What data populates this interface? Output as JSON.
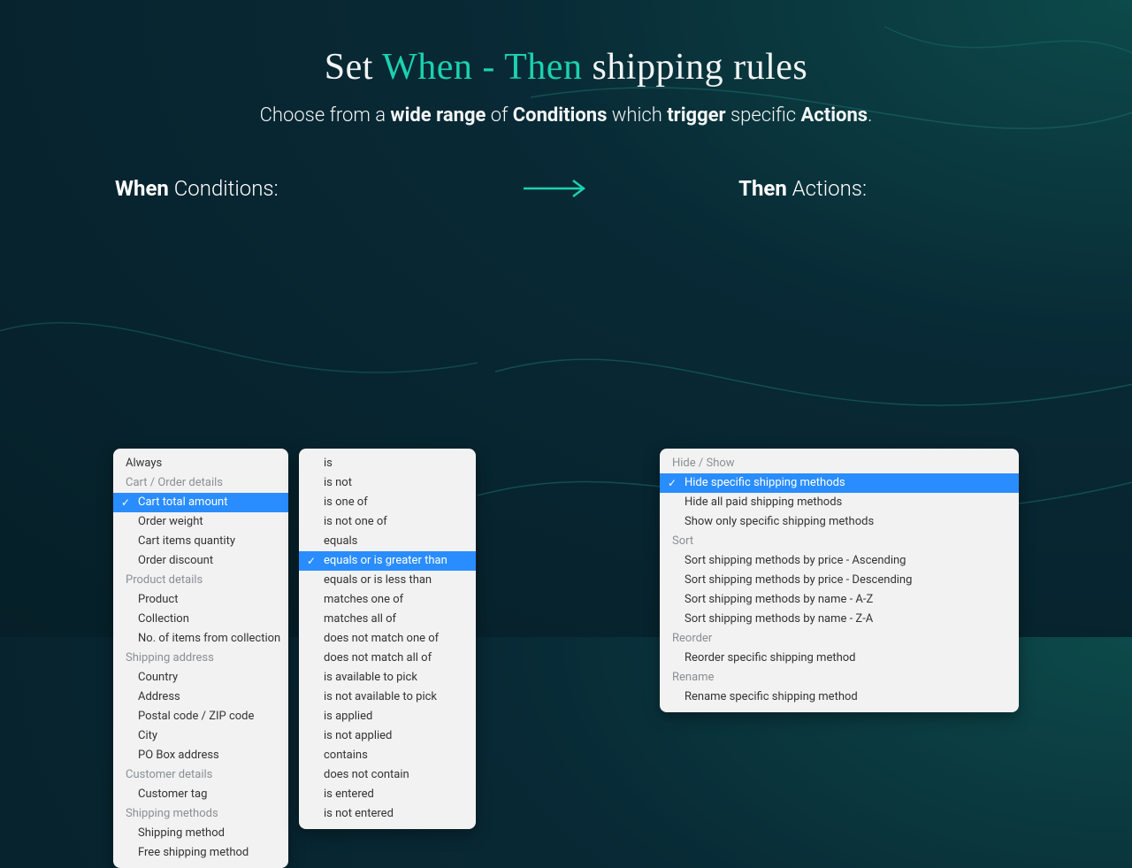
{
  "headline": {
    "prefix": "Set ",
    "accent": "When - Then",
    "suffix": " shipping rules"
  },
  "subhead": {
    "t1": "Choose from a ",
    "b1": "wide range",
    "t2": " of ",
    "b2": "Conditions",
    "t3": " which ",
    "b3": "trigger",
    "t4": " specific ",
    "b4": "Actions",
    "t5": "."
  },
  "labels": {
    "when_bold": "When",
    "when_rest": " Conditions:",
    "then_bold": "Then",
    "then_rest": " Actions:"
  },
  "conditions": {
    "always": "Always",
    "groups": [
      {
        "header": "Cart / Order details",
        "items": [
          "Cart total amount",
          "Order weight",
          "Cart items quantity",
          "Order discount"
        ],
        "selected": "Cart total amount"
      },
      {
        "header": "Product details",
        "items": [
          "Product",
          "Collection",
          "No. of items from collection"
        ]
      },
      {
        "header": "Shipping address",
        "items": [
          "Country",
          "Address",
          "Postal code / ZIP code",
          "City",
          "PO Box address"
        ]
      },
      {
        "header": "Customer details",
        "items": [
          "Customer tag"
        ]
      },
      {
        "header": "Shipping methods",
        "items": [
          "Shipping method",
          "Free shipping method"
        ]
      }
    ]
  },
  "operators": {
    "items": [
      "is",
      "is not",
      "is one of",
      "is not one of",
      "equals",
      "equals or is greater than",
      "equals or is less than",
      "matches one of",
      "matches all of",
      "does not match one of",
      "does not match all of",
      "is available to pick",
      "is not available to pick",
      "is applied",
      "is not applied",
      "contains",
      "does not contain",
      "is entered",
      "is not entered"
    ],
    "selected": "equals or is greater than"
  },
  "actions": {
    "groups": [
      {
        "header": "Hide / Show",
        "items": [
          "Hide specific shipping methods",
          "Hide all paid shipping methods",
          "Show only specific shipping methods"
        ],
        "selected": "Hide specific shipping methods"
      },
      {
        "header": "Sort",
        "items": [
          "Sort shipping methods by price - Ascending",
          "Sort shipping methods by price - Descending",
          "Sort shipping methods by name - A-Z",
          "Sort shipping methods by name - Z-A"
        ]
      },
      {
        "header": "Reorder",
        "items": [
          "Reorder specific shipping method"
        ]
      },
      {
        "header": "Rename",
        "items": [
          "Rename specific shipping method"
        ]
      }
    ]
  }
}
